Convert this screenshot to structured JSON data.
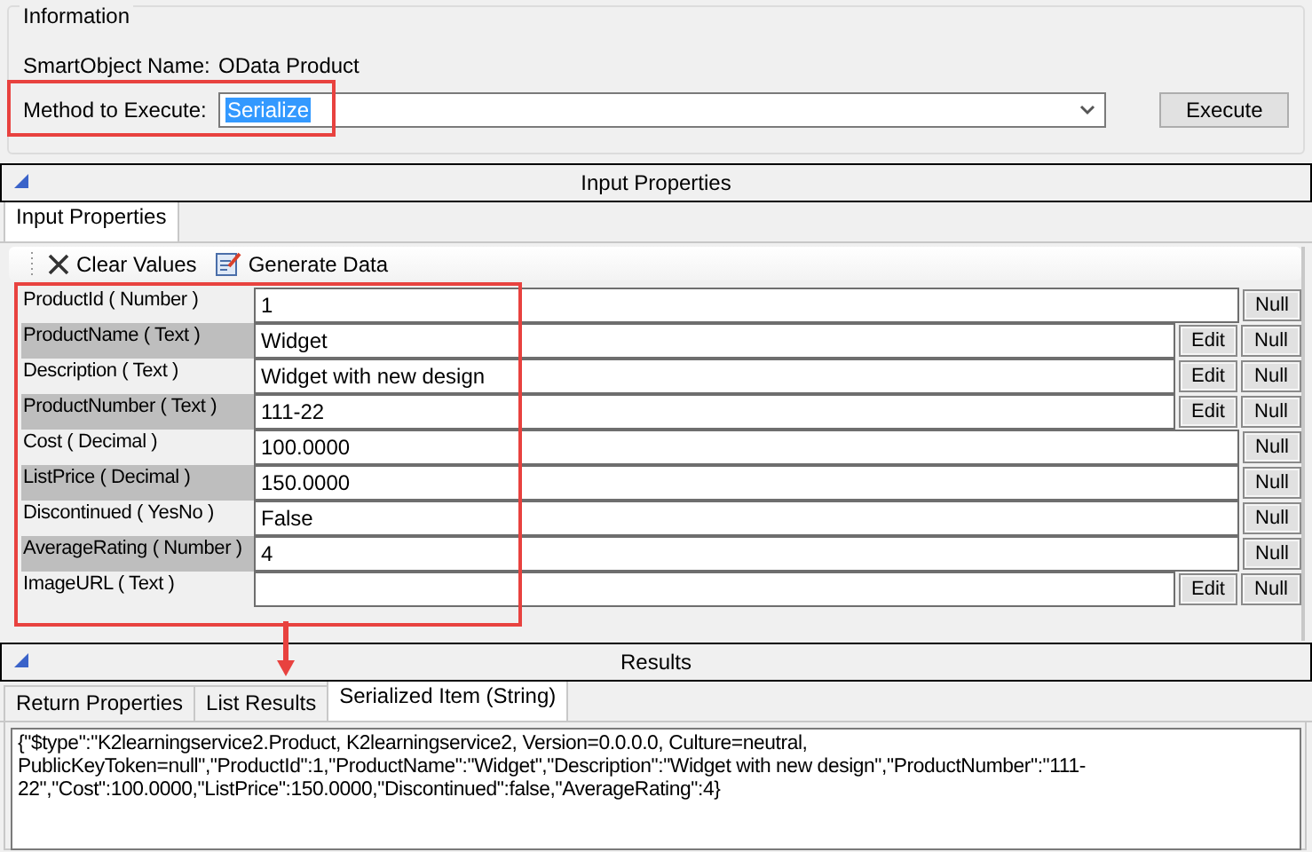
{
  "information": {
    "title": "Information",
    "smartobject_label": "SmartObject Name:",
    "smartobject_value": "OData Product",
    "method_label": "Method to Execute:",
    "method_value": "Serialize",
    "execute_button": "Execute"
  },
  "input_section": {
    "header": "Input Properties",
    "tabs": [
      {
        "label": "Input Properties",
        "selected": true
      }
    ],
    "toolbar": [
      {
        "kind": "clear",
        "label": "Clear Values"
      },
      {
        "kind": "generate",
        "label": "Generate Data"
      }
    ],
    "rows": [
      {
        "label": "ProductId ( Number )",
        "value": "1",
        "null": "Null"
      },
      {
        "label": "ProductName ( Text )",
        "value": "Widget",
        "edit": "Edit",
        "null": "Null"
      },
      {
        "label": "Description ( Text )",
        "value": "Widget with new design",
        "edit": "Edit",
        "null": "Null"
      },
      {
        "label": "ProductNumber ( Text )",
        "value": "111-22",
        "edit": "Edit",
        "null": "Null"
      },
      {
        "label": "Cost ( Decimal )",
        "value": "100.0000",
        "null": "Null"
      },
      {
        "label": "ListPrice ( Decimal )",
        "value": "150.0000",
        "null": "Null"
      },
      {
        "label": "Discontinued ( YesNo )",
        "value": "False",
        "null": "Null"
      },
      {
        "label": "AverageRating ( Number )",
        "value": "4",
        "null": "Null"
      },
      {
        "label": "ImageURL ( Text )",
        "edit": "Edit",
        "null": "Null"
      }
    ]
  },
  "results_section": {
    "header": "Results",
    "tabs": [
      {
        "label": "Return Properties",
        "selected": false
      },
      {
        "label": "List Results",
        "selected": false
      },
      {
        "label": "Serialized Item (String)",
        "selected": true
      }
    ],
    "output_lines": [
      "{\"$type\":\"K2learningservice2.Product, K2learningservice2, Version=0.0.0.0, Culture=neutral,",
      "PublicKeyToken=null\",\"ProductId\":1,\"ProductName\":\"Widget\",\"Description\":\"Widget with new design\",\"ProductNumber\":\"111-",
      "22\",\"Cost\":100.0000,\"ListPrice\":150.0000,\"Discontinued\":false,\"AverageRating\":4}"
    ]
  }
}
